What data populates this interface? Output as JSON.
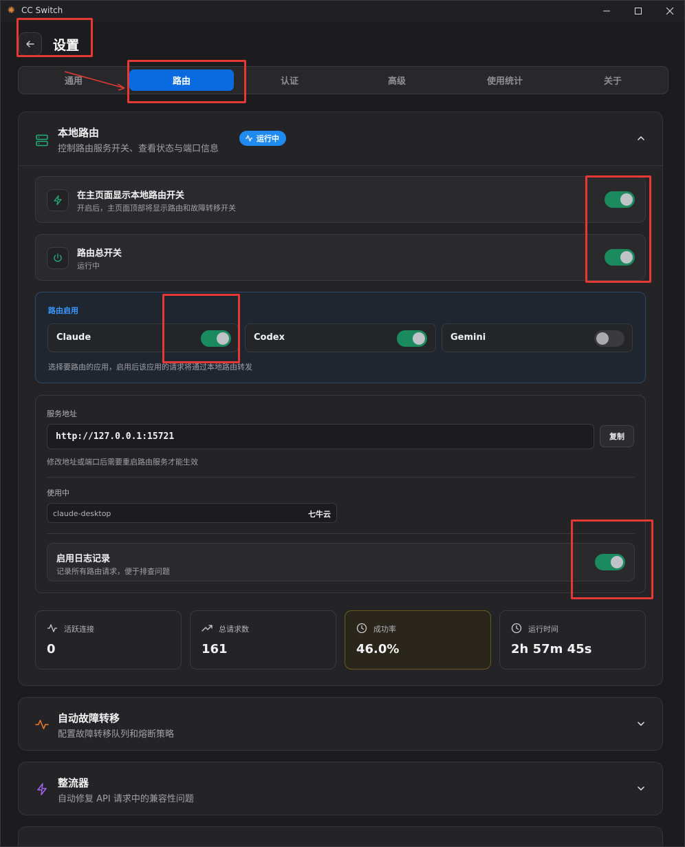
{
  "window": {
    "title": "CC Switch"
  },
  "page": {
    "title": "设置"
  },
  "tabs": [
    {
      "label": "通用"
    },
    {
      "label": "路由"
    },
    {
      "label": "认证"
    },
    {
      "label": "高级"
    },
    {
      "label": "使用统计"
    },
    {
      "label": "关于"
    }
  ],
  "local_routing": {
    "title": "本地路由",
    "subtitle": "控制路由服务开关、查看状态与端口信息",
    "status_badge": "运行中",
    "show_on_home": {
      "title": "在主页面显示本地路由开关",
      "subtitle": "开启后，主页面顶部将显示路由和故障转移开关",
      "enabled": true
    },
    "master_switch": {
      "title": "路由总开关",
      "subtitle": "运行中",
      "enabled": true
    },
    "routing_apps": {
      "label": "路由启用",
      "apps": [
        {
          "name": "Claude",
          "enabled": true
        },
        {
          "name": "Codex",
          "enabled": true
        },
        {
          "name": "Gemini",
          "enabled": false
        }
      ],
      "hint": "选择要路由的应用，启用后该应用的请求将通过本地路由转发"
    },
    "service": {
      "label": "服务地址",
      "address": "http://127.0.0.1:15721",
      "copy_label": "复制",
      "hint": "修改地址或端口后需要重启路由服务才能生效",
      "in_use_label": "使用中",
      "in_use_name": "claude-desktop",
      "in_use_provider": "七牛云",
      "log": {
        "title": "启用日志记录",
        "subtitle": "记录所有路由请求，便于排查问题",
        "enabled": true
      }
    },
    "stats": [
      {
        "label": "活跃连接",
        "value": "0",
        "icon": "activity-icon"
      },
      {
        "label": "总请求数",
        "value": "161",
        "icon": "trending-up-icon"
      },
      {
        "label": "成功率",
        "value": "46.0%",
        "icon": "clock-icon"
      },
      {
        "label": "运行时间",
        "value": "2h 57m 45s",
        "icon": "clock-icon"
      }
    ]
  },
  "failover": {
    "title": "自动故障转移",
    "subtitle": "配置故障转移队列和熔断策略"
  },
  "rectifier": {
    "title": "整流器",
    "subtitle": "自动修复 API 请求中的兼容性问题"
  },
  "colors": {
    "accent": "#0a6be0",
    "toggle_on": "#1b8a5e",
    "badge": "#1f8bf0",
    "highlight": "#e53935"
  }
}
